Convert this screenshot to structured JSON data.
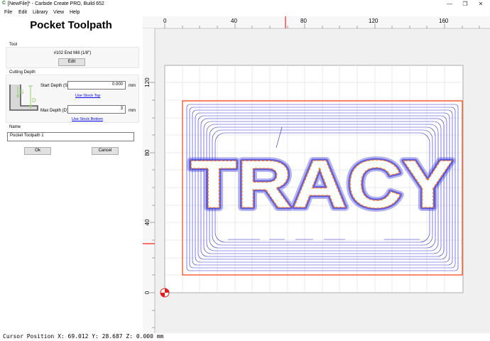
{
  "window": {
    "title": "[NewFile]* - Carbide Create PRO, Build 652",
    "app_icon": "C",
    "controls": {
      "minimize": "—",
      "maximize": "❐",
      "close": "✕"
    }
  },
  "menu": {
    "file": "File",
    "edit": "Edit",
    "library": "Library",
    "view": "View",
    "help": "Help"
  },
  "panel": {
    "title": "Pocket Toolpath",
    "tool": {
      "group_label": "Tool",
      "name": "#102 End Mill (1/8\")",
      "edit_label": "Edit"
    },
    "depth": {
      "group_label": "Cutting Depth",
      "diagram_s": "S",
      "diagram_d": "D",
      "start_label": "Start Depth (S)",
      "start_value": "0.000",
      "start_unit": "mm",
      "use_top_link": "Use Stock Top",
      "max_label": "Max Depth (D)",
      "max_value": "3",
      "max_unit": "mm",
      "use_bottom_link": "Use Stock Bottom"
    },
    "name": {
      "group_label": "Name",
      "value": "Pocket Toolpath 1"
    },
    "ok_label": "Ok",
    "cancel_label": "Cancel"
  },
  "canvas": {
    "x_ticks": [
      "0",
      "40",
      "80",
      "120",
      "160"
    ],
    "y_ticks": [
      "120",
      "80",
      "40",
      "0"
    ],
    "design_text": "TRACY",
    "colors": {
      "toolpath": "#2a2ad8",
      "outline": "#ff7a1a",
      "boundary": "#ff3b1a",
      "marker": "#e02020",
      "grid": "#cfcfcf"
    }
  },
  "status": {
    "cursor": "Cursor Position X: 69.012 Y: 28.687 Z: 0.000 mm"
  }
}
